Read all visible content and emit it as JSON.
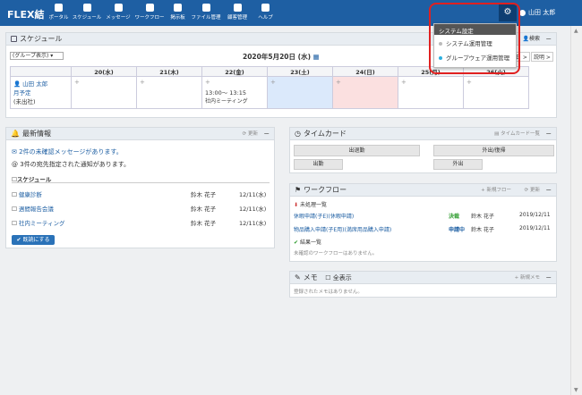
{
  "app": {
    "brand": "FLEX結"
  },
  "nav": [
    {
      "label": "ポータル",
      "icon": "bell-icon"
    },
    {
      "label": "スケジュール",
      "icon": "calendar-icon"
    },
    {
      "label": "メッセージ",
      "icon": "message-icon"
    },
    {
      "label": "ワークフロー",
      "icon": "workflow-icon"
    },
    {
      "label": "掲示板",
      "icon": "board-icon"
    },
    {
      "label": "ファイル管理",
      "icon": "file-icon"
    },
    {
      "label": "顧客管理",
      "icon": "customer-icon"
    },
    {
      "label": "ヘルプ",
      "icon": "help-icon"
    }
  ],
  "user": {
    "name": "山田 太郎"
  },
  "dropdown": {
    "header": "システム設定",
    "items": [
      "システム運用管理",
      "グループウェア運用管理"
    ]
  },
  "schedule": {
    "title": "スケジュール",
    "search": "検索",
    "group_select": "(グループ表示)",
    "date": "2020年5月20日 (水)",
    "next_btn": "説明 >",
    "prev_btn": "日 >",
    "days": [
      "20(水)",
      "21(木)",
      "22(金)",
      "23(土)",
      "24(日)",
      "25(月)",
      "26(火)"
    ],
    "user_name": "山田 太郎",
    "user_status1": "月予定",
    "user_status2": "(未出社)",
    "event_time": "13:00〜 13:15",
    "event_title": "社内ミーティング",
    "plus": "+"
  },
  "news": {
    "title": "最新情報",
    "update": "更新",
    "unconfirmed": "2件の未確認メッセージがあります。",
    "notice": "3件の宛先指定された通知があります。",
    "section": "スケジュール",
    "items": [
      {
        "title": "健康診断",
        "user": "鈴木 花子",
        "date": "12/11(水)"
      },
      {
        "title": "週間報告会議",
        "user": "鈴木 花子",
        "date": "12/11(水)"
      },
      {
        "title": "社内ミーティング",
        "user": "鈴木 花子",
        "date": "12/11(水)"
      }
    ],
    "confirm_btn": "既読にする"
  },
  "timecard": {
    "title": "タイムカード",
    "list_link": "タイムカード一覧",
    "clock_in": "出退勤",
    "outing": "外出/復帰",
    "in_label": "出勤",
    "out_label": "外出"
  },
  "workflow": {
    "title": "ワークフロー",
    "new_flow": "新規フロー",
    "update": "更新",
    "pending": "未処理一覧",
    "items": [
      {
        "title": "休暇申請(子E)(休暇申請)",
        "status": "決裁",
        "status_color": "#2a9a2a",
        "user": "鈴木 花子",
        "date": "2019/12/11"
      },
      {
        "title": "物品購入申請(子E用)(満席用品購入申請)",
        "status": "申請中",
        "status_color": "#1e5fa3",
        "user": "鈴木 花子",
        "date": "2019/12/11"
      }
    ],
    "done": "結果一覧",
    "empty": "未確認のワークフローはありません。"
  },
  "memo": {
    "title": "メモ",
    "show_all": "全表示",
    "new_memo": "新規メモ",
    "empty": "登録されたメモはありません。"
  },
  "colors": {
    "topbar": "#1e5fa3",
    "accent": "#2cb0e0",
    "highlight": "#e02020"
  }
}
